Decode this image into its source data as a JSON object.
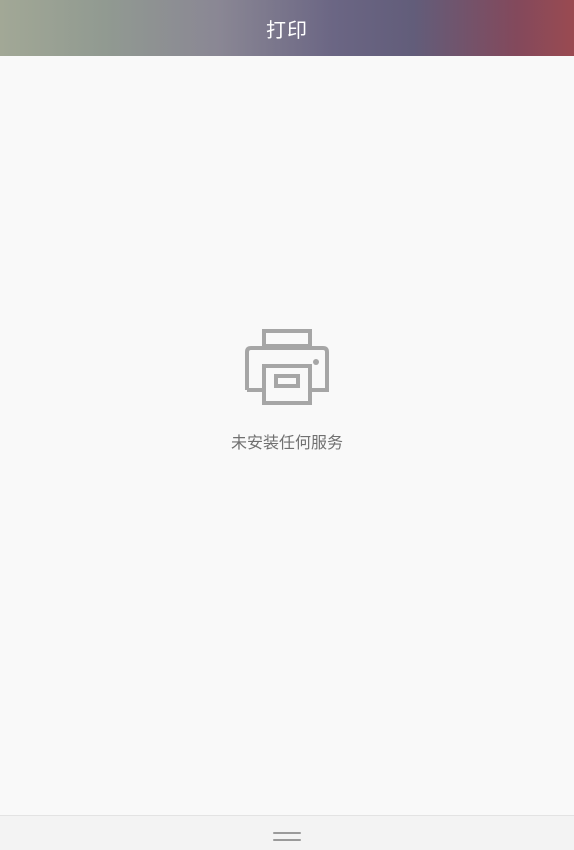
{
  "header": {
    "title": "打印"
  },
  "empty_state": {
    "icon": "printer-icon",
    "message": "未安装任何服务"
  },
  "bottom_bar": {
    "icon": "menu-handle-icon"
  },
  "colors": {
    "background": "#f9f9f9",
    "icon": "#a6a6a6",
    "text": "#707070"
  }
}
